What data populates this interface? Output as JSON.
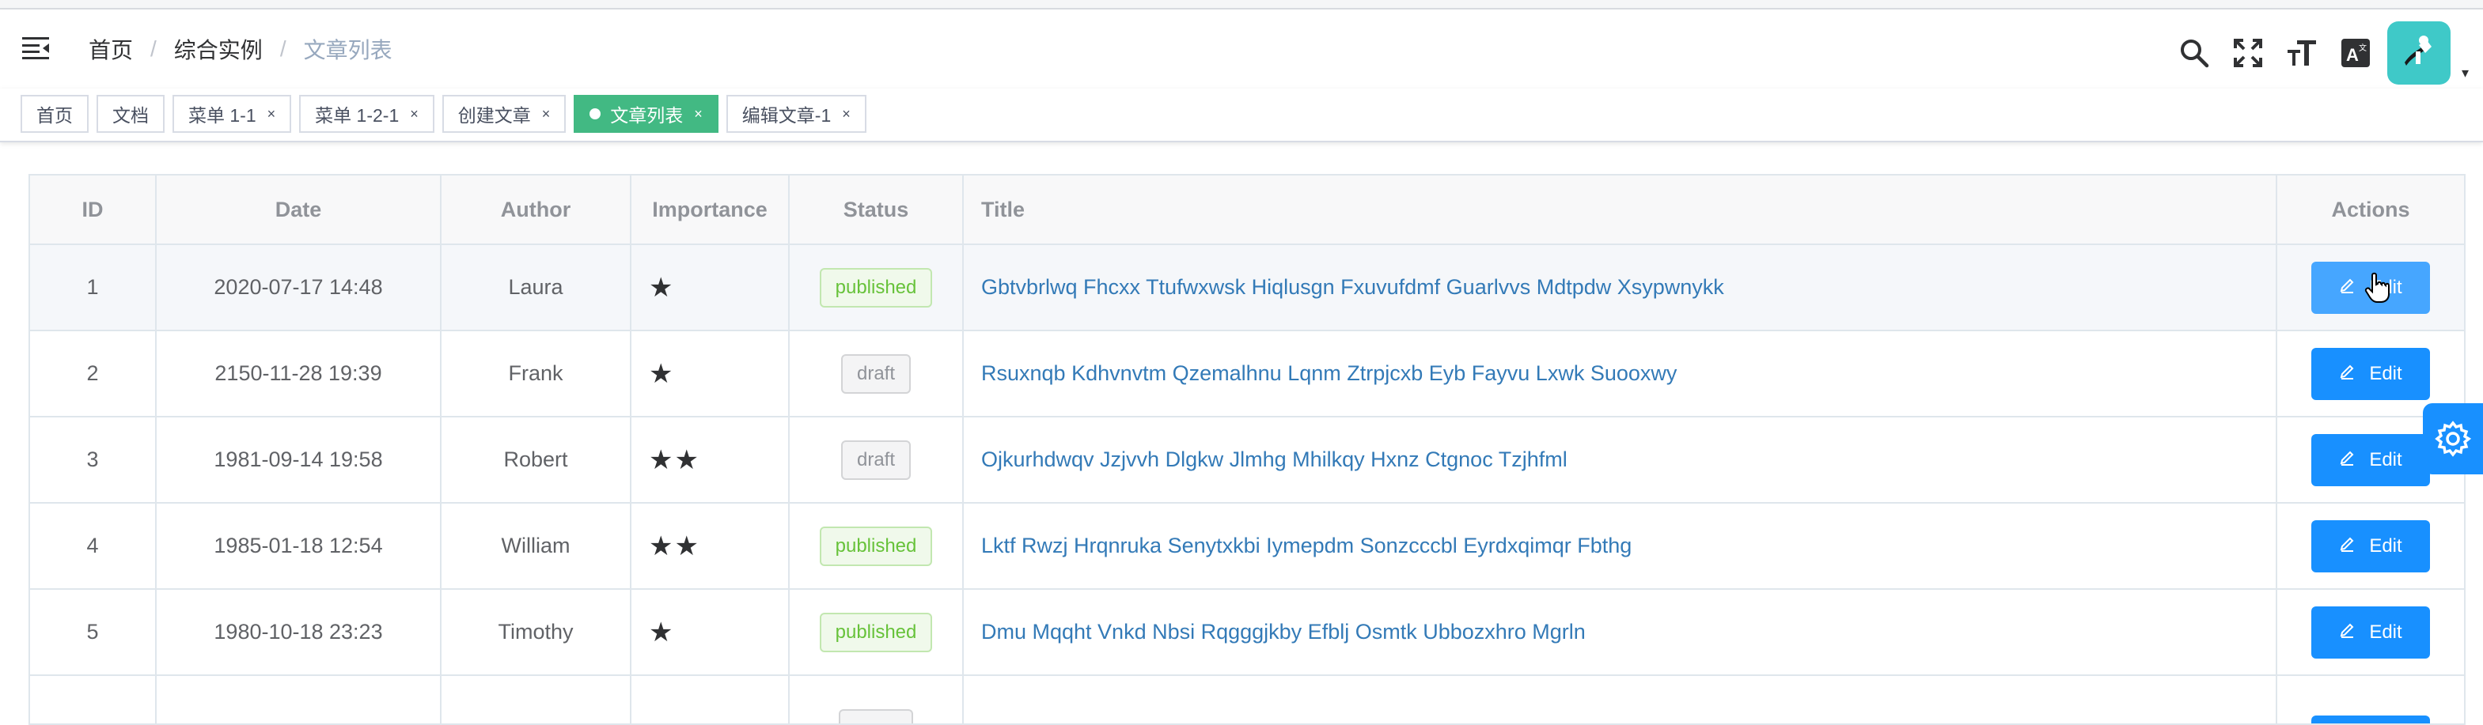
{
  "navbar": {
    "breadcrumb": [
      "首页",
      "综合实例",
      "文章列表"
    ],
    "separator": "/",
    "icons": [
      "hamburger-icon",
      "search-icon",
      "fullscreen-icon",
      "font-size-icon",
      "language-icon"
    ],
    "caret": "▾"
  },
  "tags": [
    {
      "label": "首页",
      "closable": false,
      "active": false
    },
    {
      "label": "文档",
      "closable": false,
      "active": false
    },
    {
      "label": "菜单 1-1",
      "closable": true,
      "active": false
    },
    {
      "label": "菜单 1-2-1",
      "closable": true,
      "active": false
    },
    {
      "label": "创建文章",
      "closable": true,
      "active": false
    },
    {
      "label": "文章列表",
      "closable": true,
      "active": true
    },
    {
      "label": "编辑文章-1",
      "closable": true,
      "active": false
    }
  ],
  "tag_close": "×",
  "table": {
    "headers": {
      "id": "ID",
      "date": "Date",
      "author": "Author",
      "importance": "Importance",
      "status": "Status",
      "title": "Title",
      "actions": "Actions"
    },
    "edit_label": "Edit",
    "rows": [
      {
        "id": "1",
        "date": "2020-07-17 14:48",
        "author": "Laura",
        "importance": 1,
        "status": "published",
        "title": "Gbtvbrlwq Fhcxx Ttufwxwsk Hiqlusgn Fxuvufdmf Guarlvvs Mdtpdw Xsypwnykk"
      },
      {
        "id": "2",
        "date": "2150-11-28 19:39",
        "author": "Frank",
        "importance": 1,
        "status": "draft",
        "title": "Rsuxnqb Kdhvnvtm Qzemalhnu Lqnm Ztrpjcxb Eyb Fayvu Lxwk Suooxwy"
      },
      {
        "id": "3",
        "date": "1981-09-14 19:58",
        "author": "Robert",
        "importance": 2,
        "status": "draft",
        "title": "Ojkurhdwqv Jzjvvh Dlgkw Jlmhg Mhilkqy Hxnz Ctgnoc Tzjhfml"
      },
      {
        "id": "4",
        "date": "1985-01-18 12:54",
        "author": "William",
        "importance": 2,
        "status": "published",
        "title": "Lktf Rwzj Hrqnruka Senytxkbi Iymepdm Sonzcccbl Eyrdxqimqr Fbthg"
      },
      {
        "id": "5",
        "date": "1980-10-18 23:23",
        "author": "Timothy",
        "importance": 1,
        "status": "published",
        "title": "Dmu Mqqht Vnkd Nbsi Rqgggjkby Efblj Osmtk Ubbozxhro Mgrln"
      }
    ]
  },
  "colors": {
    "primary": "#1890ff",
    "active_tag": "#42b983",
    "link": "#337ab7"
  }
}
